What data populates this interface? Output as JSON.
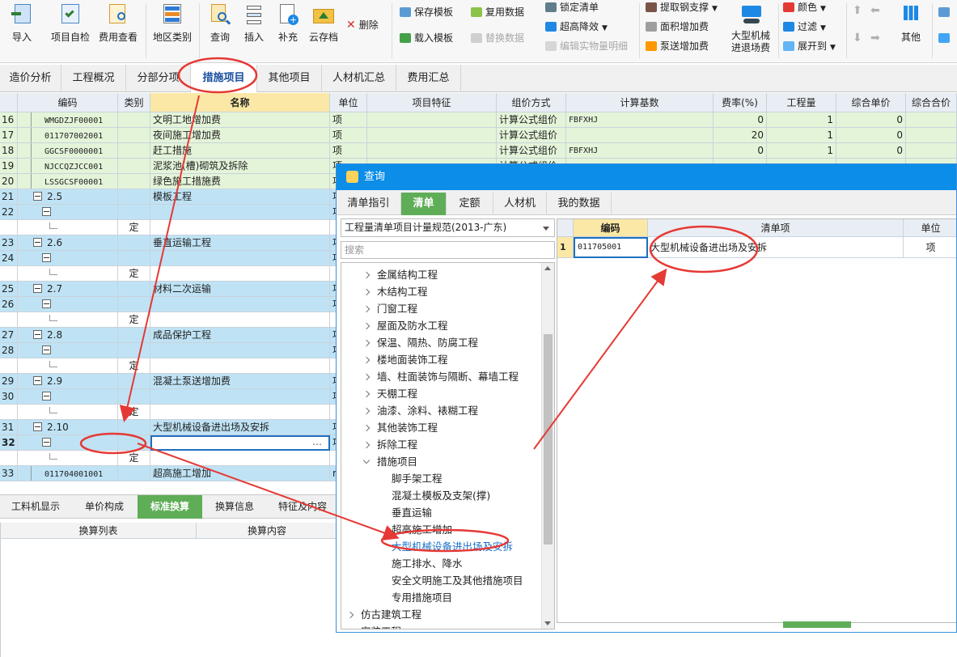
{
  "ribbon": {
    "big_buttons": [
      {
        "label": "导入",
        "icon": "import-icon"
      },
      {
        "label": "项目自检",
        "icon": "check-icon"
      },
      {
        "label": "费用查看",
        "icon": "fee-view-icon"
      },
      {
        "label": "地区类别",
        "icon": "region-icon"
      },
      {
        "label": "查询",
        "icon": "query-icon"
      },
      {
        "label": "插入",
        "icon": "insert-icon"
      },
      {
        "label": "补充",
        "icon": "supplement-icon"
      },
      {
        "label": "云存档",
        "icon": "cloud-save-icon"
      }
    ],
    "delete_label": "删除",
    "col1": [
      "保存模板",
      "载入模板"
    ],
    "col2": [
      "复用数据",
      "替换数据"
    ],
    "col3": [
      "锁定清单",
      "超高降效",
      "编辑实物量明细"
    ],
    "col4": [
      "提取钢支撑",
      "面积增加费",
      "泵送增加费"
    ],
    "machine_label": "大型机械\n进退场费",
    "col5": [
      "颜色",
      "过滤",
      "展开到"
    ],
    "other_label": "其他"
  },
  "main_tabs": [
    "造价分析",
    "工程概况",
    "分部分项",
    "措施项目",
    "其他项目",
    "人材机汇总",
    "费用汇总"
  ],
  "grid_header": [
    "编码",
    "类别",
    "名称",
    "单位",
    "项目特征",
    "组价方式",
    "计算基数",
    "费率(%)",
    "工程量",
    "综合单价",
    "综合合价"
  ],
  "grid_rows": [
    {
      "n": "16",
      "code": "WMGDZJF00001",
      "type": "",
      "name": "文明工地增加费",
      "unit": "项",
      "method": "计算公式组价",
      "base": "FBFXHJ",
      "rate": "0",
      "qty": "1",
      "price": "0",
      "style": "green"
    },
    {
      "n": "17",
      "code": "011707002001",
      "type": "",
      "name": "夜间施工增加费",
      "unit": "项",
      "method": "计算公式组价",
      "base": "",
      "rate": "20",
      "qty": "1",
      "price": "0",
      "style": "green"
    },
    {
      "n": "18",
      "code": "GGCSF0000001",
      "type": "",
      "name": "赶工措施",
      "unit": "项",
      "method": "计算公式组价",
      "base": "FBFXHJ",
      "rate": "0",
      "qty": "1",
      "price": "0",
      "style": "green"
    },
    {
      "n": "19",
      "code": "NJCCQZJCC001",
      "type": "",
      "name": "泥浆池(槽)砌筑及拆除",
      "unit": "项",
      "method": "计算公式组价",
      "base": "",
      "rate": "",
      "qty": "",
      "price": "",
      "style": "green"
    },
    {
      "n": "20",
      "code": "LSSGCSF00001",
      "type": "",
      "name": "绿色施工措施费",
      "unit": "项",
      "method": "",
      "base": "",
      "rate": "",
      "qty": "",
      "price": "",
      "style": "green"
    },
    {
      "n": "21",
      "code": "2.5",
      "type": "",
      "name": "模板工程",
      "unit": "项",
      "style": "blue",
      "exp": "1"
    },
    {
      "n": "22",
      "code": "",
      "type": "",
      "name": "",
      "unit": "项",
      "style": "blue",
      "exp": "2"
    },
    {
      "n": "",
      "code": "",
      "type": "定",
      "name": "",
      "unit": "",
      "style": "white",
      "exp": "3"
    },
    {
      "n": "23",
      "code": "2.6",
      "type": "",
      "name": "垂直运输工程",
      "unit": "项",
      "style": "blue",
      "exp": "1"
    },
    {
      "n": "24",
      "code": "",
      "type": "",
      "name": "",
      "unit": "项",
      "style": "blue",
      "exp": "2"
    },
    {
      "n": "",
      "code": "",
      "type": "定",
      "name": "",
      "unit": "",
      "style": "white",
      "exp": "3"
    },
    {
      "n": "25",
      "code": "2.7",
      "type": "",
      "name": "材料二次运输",
      "unit": "项",
      "style": "blue",
      "exp": "1"
    },
    {
      "n": "26",
      "code": "",
      "type": "",
      "name": "",
      "unit": "项",
      "style": "blue",
      "exp": "2"
    },
    {
      "n": "",
      "code": "",
      "type": "定",
      "name": "",
      "unit": "",
      "style": "white",
      "exp": "3"
    },
    {
      "n": "27",
      "code": "2.8",
      "type": "",
      "name": "成品保护工程",
      "unit": "项",
      "style": "blue",
      "exp": "1"
    },
    {
      "n": "28",
      "code": "",
      "type": "",
      "name": "",
      "unit": "项",
      "style": "blue",
      "exp": "2"
    },
    {
      "n": "",
      "code": "",
      "type": "定",
      "name": "",
      "unit": "",
      "style": "white",
      "exp": "3"
    },
    {
      "n": "29",
      "code": "2.9",
      "type": "",
      "name": "混凝土泵送增加费",
      "unit": "项",
      "style": "blue",
      "exp": "1"
    },
    {
      "n": "30",
      "code": "",
      "type": "",
      "name": "",
      "unit": "项",
      "style": "blue",
      "exp": "2"
    },
    {
      "n": "",
      "code": "",
      "type": "定",
      "name": "",
      "unit": "",
      "style": "white",
      "exp": "3"
    },
    {
      "n": "31",
      "code": "2.10",
      "type": "",
      "name": "大型机械设备进出场及安拆",
      "unit": "项",
      "style": "blue",
      "exp": "1"
    },
    {
      "n": "32",
      "code": "",
      "type": "",
      "name": "",
      "unit": "项",
      "style": "selected",
      "exp": "2"
    },
    {
      "n": "",
      "code": "",
      "type": "定",
      "name": "",
      "unit": "",
      "style": "white",
      "exp": "3"
    },
    {
      "n": "33",
      "code": "011704001001",
      "type": "",
      "name": "超高施工增加",
      "unit": "m",
      "style": "blue"
    }
  ],
  "bottom_tabs": [
    "工料机显示",
    "单价构成",
    "标准换算",
    "换算信息",
    "特征及内容"
  ],
  "bottom_head": [
    "换算列表",
    "换算内容"
  ],
  "dialog": {
    "title": "查询",
    "tabs": [
      "清单指引",
      "清单",
      "定额",
      "人材机",
      "我的数据"
    ],
    "select_value": "工程量清单项目计量规范(2013-广东)",
    "search_placeholder": "搜索",
    "tree": [
      {
        "label": "金属结构工程",
        "level": 1
      },
      {
        "label": "木结构工程",
        "level": 1
      },
      {
        "label": "门窗工程",
        "level": 1
      },
      {
        "label": "屋面及防水工程",
        "level": 1
      },
      {
        "label": "保温、隔热、防腐工程",
        "level": 1
      },
      {
        "label": "楼地面装饰工程",
        "level": 1
      },
      {
        "label": "墙、柱面装饰与隔断、幕墙工程",
        "level": 1
      },
      {
        "label": "天棚工程",
        "level": 1
      },
      {
        "label": "油漆、涂料、裱糊工程",
        "level": 1
      },
      {
        "label": "其他装饰工程",
        "level": 1
      },
      {
        "label": "拆除工程",
        "level": 1
      },
      {
        "label": "措施项目",
        "level": 1,
        "open": true
      },
      {
        "label": "脚手架工程",
        "level": 2
      },
      {
        "label": "混凝土模板及支架(撑)",
        "level": 2
      },
      {
        "label": "垂直运输",
        "level": 2
      },
      {
        "label": "超高施工增加",
        "level": 2
      },
      {
        "label": "大型机械设备进出场及安拆",
        "level": 2,
        "link": true
      },
      {
        "label": "施工排水、降水",
        "level": 2
      },
      {
        "label": "安全文明施工及其他措施项目",
        "level": 2
      },
      {
        "label": "专用措施项目",
        "level": 2
      },
      {
        "label": "仿古建筑工程",
        "level": 0
      },
      {
        "label": "安装工程",
        "level": 0
      }
    ],
    "result_header": [
      "编码",
      "清单项",
      "单位"
    ],
    "results": [
      {
        "n": "1",
        "code": "011705001",
        "name": "大型机械设备进出场及安拆",
        "unit": "项"
      }
    ]
  },
  "colors": {
    "accent": "#0b8de8",
    "green_tab": "#5fae57",
    "row_green": "#e4f4d9",
    "row_blue": "#bfe3f5",
    "annotation": "#e53935"
  }
}
